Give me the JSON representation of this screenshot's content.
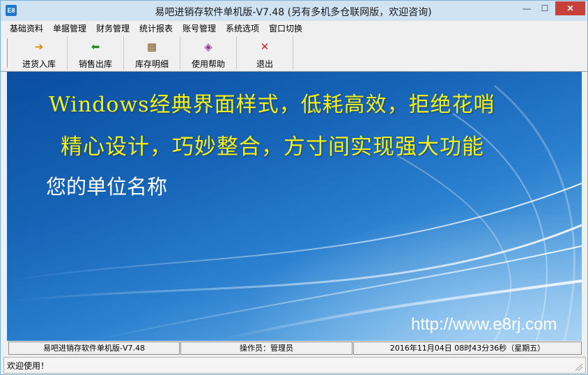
{
  "window": {
    "title": "易吧进销存软件单机版-V7.48 (另有多机多仓联网版，欢迎咨询)",
    "icon_label": "E8",
    "controls": {
      "minimize": "—",
      "maximize": "☐",
      "close": "✕"
    }
  },
  "menu": [
    "基础资料",
    "单据管理",
    "财务管理",
    "统计报表",
    "账号管理",
    "系统选项",
    "窗口切换"
  ],
  "toolbar": [
    {
      "label": "进货入库",
      "icon": "inbound-arrow-icon",
      "glyph": "➔",
      "color": "#d48a00"
    },
    {
      "label": "销售出库",
      "icon": "outbound-arrow-icon",
      "glyph": "⬅",
      "color": "#2a8a2a"
    },
    {
      "label": "库存明细",
      "icon": "inventory-icon",
      "glyph": "▦",
      "color": "#7a5a20"
    },
    {
      "label": "使用帮助",
      "icon": "help-book-icon",
      "glyph": "◈",
      "color": "#8a3a8a"
    },
    {
      "label": "退出",
      "icon": "exit-x-icon",
      "glyph": "✕",
      "color": "#e02020"
    }
  ],
  "banner": {
    "slogan_line1": "Windows经典界面样式，低耗高效，拒绝花哨",
    "slogan_line2": "精心设计，巧妙整合，方寸间实现强大功能",
    "company_name": "您的单位名称",
    "url": "http://www.e8rj.com"
  },
  "status": {
    "app_version": "易吧进销存软件单机版-V7.48",
    "operator": "操作员：管理员",
    "datetime": "2016年11月04日 08时43分36秒（星期五）",
    "message": "欢迎使用！"
  }
}
